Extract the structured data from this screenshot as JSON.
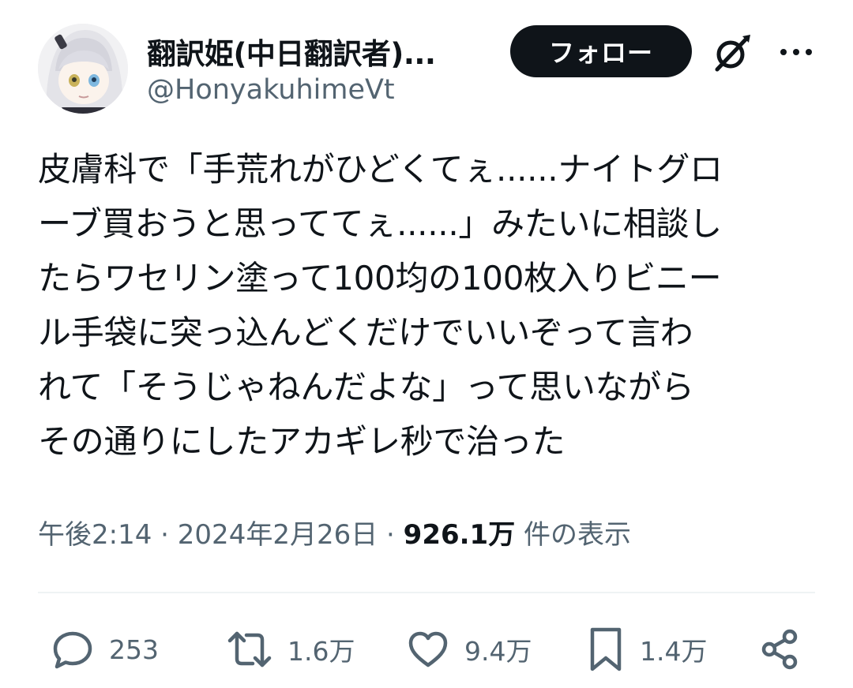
{
  "author": {
    "display_name": "翻訳姫(中日翻訳者)...",
    "handle": "@HonyakuhimeVt"
  },
  "header": {
    "follow_label": "フォロー",
    "grok_icon": "grok-icon",
    "more_icon": "more-icon"
  },
  "tweet": {
    "text": "皮膚科で「手荒れがひどくてぇ......ナイトグロ\nーブ買おうと思っててぇ......」みたいに相談し\nたらワセリン塗って100均の100枚入りビニー\nル手袋に突っ込んどくだけでいいぞって言わ\nれて「そうじゃねんだよな」って思いながら\nその通りにしたアカギレ秒で治った"
  },
  "meta": {
    "time": "午後2:14",
    "separator1": " · ",
    "date": "2024年2月26日",
    "separator2": " · ",
    "views": "926.1万",
    "views_label": " 件の表示"
  },
  "actions": {
    "replies": "253",
    "reposts": "1.6万",
    "likes": "9.4万",
    "bookmarks": "1.4万",
    "icons": [
      "reply-icon",
      "repost-icon",
      "like-icon",
      "bookmark-icon",
      "share-icon"
    ]
  },
  "colors": {
    "text": "#0f1419",
    "secondary": "#536471",
    "button_bg": "#0f1419",
    "button_text": "#ffffff",
    "divider": "#eff3f4"
  }
}
